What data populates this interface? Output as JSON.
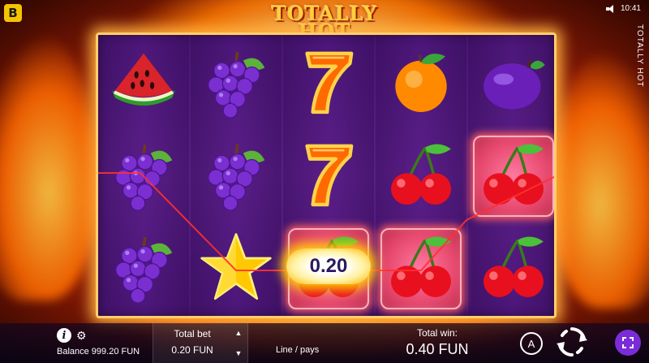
{
  "header": {
    "brand_logo": "B",
    "game_title": "TOTALLY HOT",
    "clock": "10:41",
    "game_name_vertical": "TOTALLY HOT",
    "speaker_icon": "speaker-icon"
  },
  "reels": {
    "columns": [
      [
        "watermelon",
        "grapes",
        "grapes"
      ],
      [
        "grapes",
        "grapes",
        "star"
      ],
      [
        "seven",
        "seven",
        "cherry"
      ],
      [
        "orange",
        "cherry",
        "cherry"
      ],
      [
        "plum",
        "cherry",
        "cherry"
      ]
    ],
    "winning_cells": [
      [
        2,
        2
      ],
      [
        3,
        2
      ],
      [
        4,
        1
      ]
    ],
    "line_win": "0.20"
  },
  "footer": {
    "balance": "Balance 999.20 FUN",
    "total_bet_label": "Total bet",
    "total_bet_value": "0.20 FUN",
    "lines_label": "Line / pays",
    "total_win_label": "Total win:",
    "total_win_value": "0.40 FUN",
    "auto_label": "A"
  },
  "colors": {
    "reel_bg": "#4a1676",
    "frame_gold": "#ffce6a",
    "fullscreen_btn": "#7a2cd8",
    "win_badge_text": "#2a1a5c"
  }
}
